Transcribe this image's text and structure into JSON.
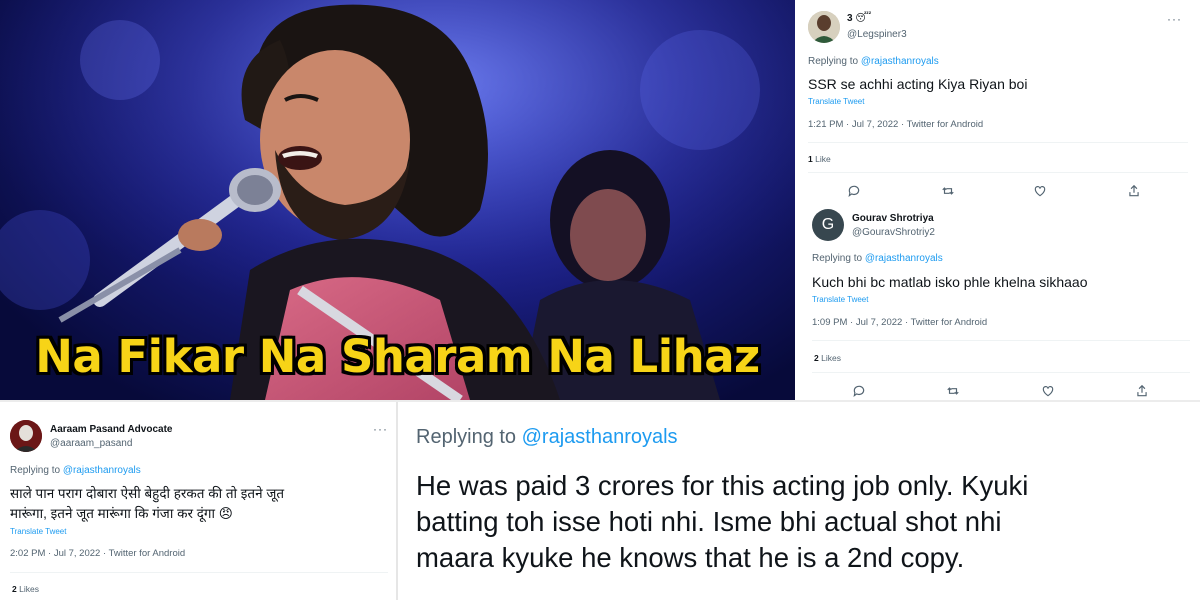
{
  "meme": {
    "caption": "Na Fikar Na Sharam Na Lihaz"
  },
  "tweet1": {
    "name": "3 😴",
    "handle": "@Legspiner3",
    "reply_prefix": "Replying to ",
    "reply_mention": "@rajasthanroyals",
    "text": "SSR se achhi acting Kiya Riyan boi",
    "translate": "Translate Tweet",
    "meta": "1:21 PM · Jul 7, 2022 · Twitter for Android",
    "likes_count": "1",
    "likes_label": " Like",
    "more": "···"
  },
  "tweet2": {
    "name": "Gourav Shrotriya",
    "handle": "@GouravShrotriy2",
    "avatar_letter": "G",
    "reply_prefix": "Replying to ",
    "reply_mention": "@rajasthanroyals",
    "text": "Kuch bhi bc matlab isko phle khelna sikhaao",
    "translate": "Translate Tweet",
    "meta": "1:09 PM · Jul 7, 2022 · Twitter for Android",
    "likes_count": "2",
    "likes_label": " Likes"
  },
  "tweet3": {
    "name": "Aaraam Pasand Advocate",
    "handle": "@aaraam_pasand",
    "reply_prefix": "Replying to ",
    "reply_mention": "@rajasthanroyals",
    "text_line1": "साले पान पराग दोबारा ऐसी बेहुदी हरकत की तो इतने जूत",
    "text_line2": "मारूंगा, इतने जूत मारूंगा कि गंजा कर दूंगा 😠",
    "translate": "Translate Tweet",
    "meta": "2:02 PM · Jul 7, 2022 · Twitter for Android",
    "likes_count": "2",
    "likes_label": " Likes",
    "more": "···"
  },
  "zoomed_reply": {
    "reply_prefix": "Replying to ",
    "reply_mention": "@rajasthanroyals",
    "line1": "He was paid 3 crores for this acting job only. Kyuki",
    "line2": "batting toh isse hoti nhi. Isme bhi actual shot nhi",
    "line3": "maara kyuke he knows that he is a 2nd copy."
  },
  "colors": {
    "caption_yellow": "#f7d417",
    "link_blue": "#1d9bf0",
    "secondary_text": "#536471",
    "stage_blue": "#1b1f86"
  },
  "icons": [
    "reply-icon",
    "retweet-icon",
    "like-icon",
    "share-icon",
    "more-icon"
  ]
}
